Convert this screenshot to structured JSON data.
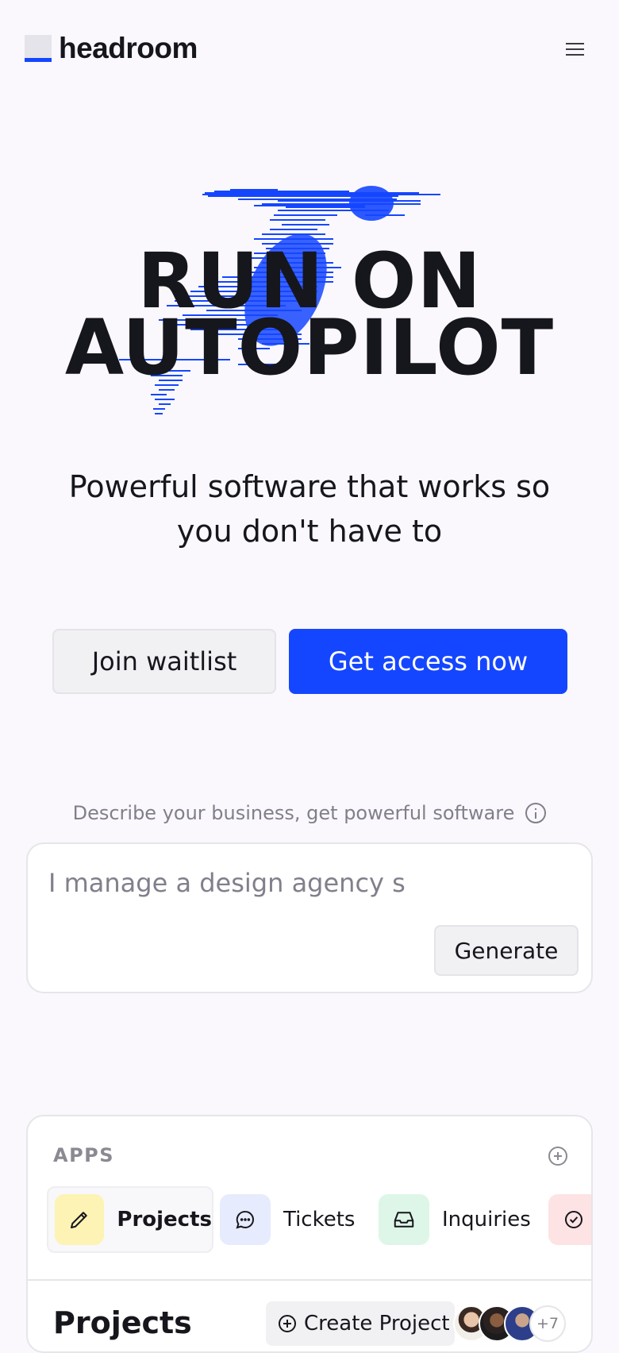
{
  "header": {
    "brand": "headroom",
    "menu_icon": "hamburger-menu-icon"
  },
  "hero": {
    "title_line1": "RUN ON",
    "title_line2": "AUTOPILOT",
    "illustration": "running-figure-scanlines",
    "subtitle": "Powerful software that works so you don't have to"
  },
  "cta": {
    "secondary_label": "Join waitlist",
    "primary_label": "Get access now"
  },
  "generator": {
    "label": "Describe your business, get powerful software",
    "info_icon": "info-icon",
    "input_value": "I manage a design agency s",
    "generate_label": "Generate"
  },
  "apps": {
    "section_label": "APPS",
    "add_icon": "plus-circle-icon",
    "tabs": [
      {
        "label": "Projects",
        "icon": "pencil-icon",
        "bg": "#fdf3b5"
      },
      {
        "label": "Tickets",
        "icon": "chat-bubble-icon",
        "bg": "#e6ebfd"
      },
      {
        "label": "Inquiries",
        "icon": "inbox-icon",
        "bg": "#ddf6e8"
      },
      {
        "label": "",
        "icon": "check-circle-icon",
        "bg": "#fde3e3"
      }
    ],
    "panel_title": "Projects",
    "create_label": "Create Project",
    "extra_members": "+7"
  },
  "colors": {
    "accent": "#1546ff",
    "background": "#faf8fc",
    "text": "#16161d"
  }
}
